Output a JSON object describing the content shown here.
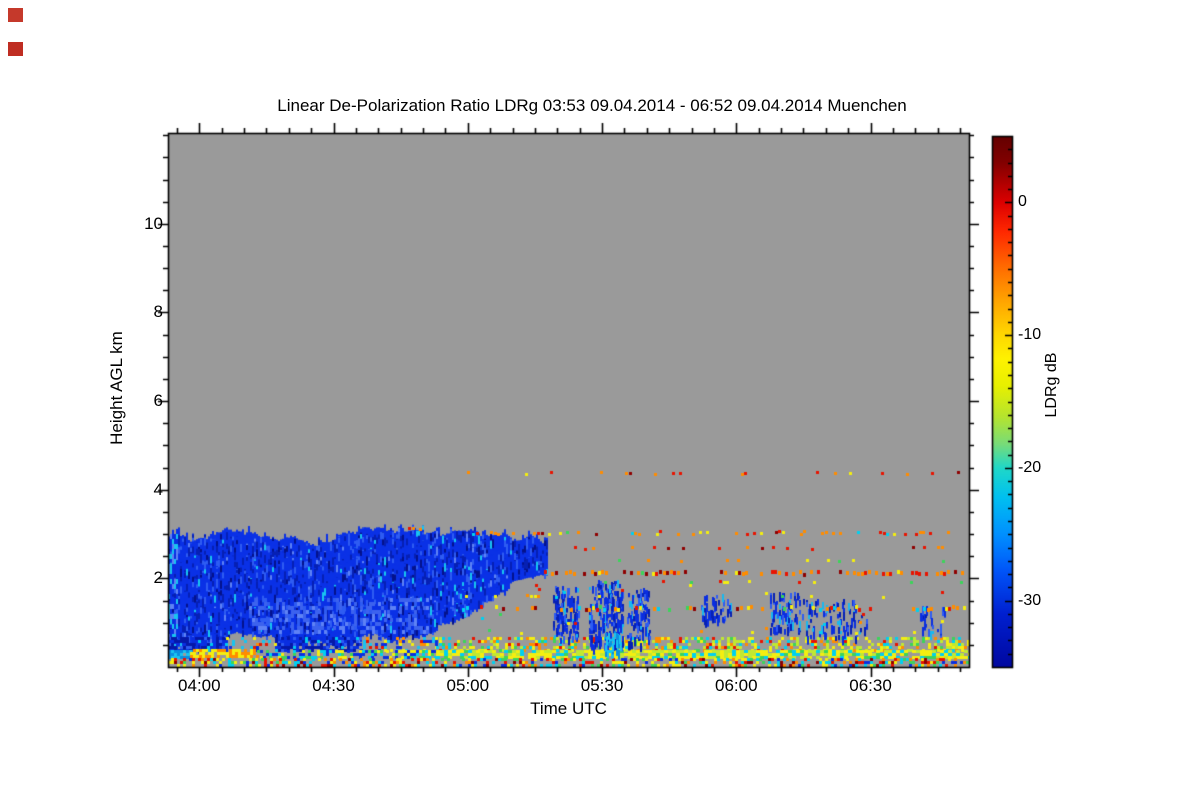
{
  "title": "Linear De-Polarization Ratio LDRg   03:53 09.04.2014 - 06:52 09.04.2014 Muenchen",
  "corner_markers": [
    {
      "color": "#c5392b"
    },
    {
      "color": "#bf2d22"
    }
  ],
  "axes": {
    "x": {
      "label": "Time UTC",
      "start_label": "03:53",
      "end_label": "06:52",
      "total_minutes": 179,
      "minor_step_min": 5,
      "ticks": [
        {
          "label": "04:00",
          "min": 7
        },
        {
          "label": "04:30",
          "min": 37
        },
        {
          "label": "05:00",
          "min": 67
        },
        {
          "label": "05:30",
          "min": 97
        },
        {
          "label": "06:00",
          "min": 127
        },
        {
          "label": "06:30",
          "min": 157
        }
      ]
    },
    "y": {
      "label": "Height AGL km",
      "min_km": 0,
      "max_km": 12.05,
      "minor_step_km": 0.5,
      "ticks": [
        {
          "label": "2",
          "km": 2
        },
        {
          "label": "4",
          "km": 4
        },
        {
          "label": "6",
          "km": 6
        },
        {
          "label": "8",
          "km": 8
        },
        {
          "label": "10",
          "km": 10
        }
      ]
    }
  },
  "colorbar": {
    "label": "LDRg dB",
    "max": 5,
    "min": -35,
    "minor_step": 1,
    "ticks": [
      {
        "label": "0",
        "value": 0
      },
      {
        "label": "-10",
        "value": -10
      },
      {
        "label": "-20",
        "value": -20
      },
      {
        "label": "-30",
        "value": -30
      }
    ],
    "gradient": [
      [
        0.0,
        "#640000"
      ],
      [
        0.05,
        "#820000"
      ],
      [
        0.125,
        "#dc0000"
      ],
      [
        0.18,
        "#ff2800"
      ],
      [
        0.25,
        "#ff6e00"
      ],
      [
        0.31,
        "#ffa400"
      ],
      [
        0.375,
        "#ffd800"
      ],
      [
        0.42,
        "#fef200"
      ],
      [
        0.47,
        "#e8f000"
      ],
      [
        0.53,
        "#b4e430"
      ],
      [
        0.58,
        "#78dc78"
      ],
      [
        0.625,
        "#20d8c8"
      ],
      [
        0.68,
        "#00c0f0"
      ],
      [
        0.75,
        "#0090ff"
      ],
      [
        0.82,
        "#0054f8"
      ],
      [
        0.9,
        "#0020d0"
      ],
      [
        1.0,
        "#0008a0"
      ]
    ]
  },
  "chart_data": {
    "type": "heatmap",
    "title": "Linear De-Polarization Ratio LDRg   03:53 09.04.2014 - 06:52 09.04.2014 Muenchen",
    "xlabel": "Time UTC",
    "ylabel": "Height AGL km",
    "x_range_minutes": [
      0,
      179
    ],
    "y_range_km": [
      0,
      12.05
    ],
    "value_range_db": [
      -35,
      5
    ],
    "background": "#9a9a9a",
    "seed": 20140409,
    "palettes": {
      "cloud": [
        [
          "#0a31e6",
          0.5
        ],
        [
          "#0620b4",
          0.2
        ],
        [
          "#04128c",
          0.08
        ],
        [
          "#2e5cf2",
          0.15
        ],
        [
          "#18c4f0",
          0.04
        ],
        [
          "#5e82f5",
          0.03
        ]
      ],
      "blues": [
        [
          "#0a2ee0",
          0.45
        ],
        [
          "#0620b4",
          0.25
        ],
        [
          "#2e5cf2",
          0.2
        ],
        [
          "#18b8f0",
          0.1
        ]
      ],
      "cyanBlue": [
        [
          "#18c4f0",
          0.55
        ],
        [
          "#0a8ee0",
          0.45
        ]
      ],
      "paleBlues": [
        [
          "#3c62ee",
          0.5
        ],
        [
          "#5e82f5",
          0.3
        ],
        [
          "#2e5cf2",
          0.2
        ]
      ],
      "edgeMix": [
        [
          "#18c4f0",
          0.4
        ],
        [
          "#5e82f5",
          0.3
        ],
        [
          "#0a2ee0",
          0.3
        ]
      ],
      "bluesB": [
        [
          "#0518a8",
          0.4
        ],
        [
          "#0a2ee0",
          0.35
        ],
        [
          "#00c8f0",
          0.1
        ],
        [
          "#2e5cf2",
          0.15
        ]
      ],
      "mixLeft": [
        [
          "#0a2ee0",
          0.3
        ],
        [
          "#18c4f0",
          0.2
        ],
        [
          "#f4ee10",
          0.2
        ],
        [
          "#ff8c00",
          0.15
        ],
        [
          "#e81400",
          0.15
        ]
      ],
      "warmMix": [
        [
          "#f4ee10",
          0.3
        ],
        [
          "#c0e832",
          0.25
        ],
        [
          "#ff8c00",
          0.15
        ],
        [
          "#00d0f0",
          0.12
        ],
        [
          "#3cd45a",
          0.1
        ],
        [
          "#e81400",
          0.08
        ]
      ],
      "brightLine": [
        [
          "#f4ee10",
          0.45
        ],
        [
          "#c0e832",
          0.3
        ],
        [
          "#00d0f0",
          0.15
        ],
        [
          "#3cd45a",
          0.1
        ]
      ],
      "mixB": [
        [
          "#0a2ee0",
          0.3
        ],
        [
          "#00d0f0",
          0.25
        ],
        [
          "#f4ee10",
          0.25
        ],
        [
          "#3cd45a",
          0.2
        ]
      ],
      "groundMix": [
        [
          "#f4ee10",
          0.2
        ],
        [
          "#00d0f0",
          0.18
        ],
        [
          "#e81400",
          0.14
        ],
        [
          "#ff8c00",
          0.14
        ],
        [
          "#3cd45a",
          0.12
        ],
        [
          "#0a2ee0",
          0.12
        ],
        [
          "#8f0000",
          0.1
        ]
      ],
      "warmDots": [
        [
          "#ff8c00",
          0.4
        ],
        [
          "#e81400",
          0.25
        ],
        [
          "#f4ee10",
          0.25
        ],
        [
          "#8f0000",
          0.1
        ]
      ],
      "redDots": [
        [
          "#e81400",
          0.55
        ],
        [
          "#ff8c00",
          0.3
        ],
        [
          "#8f0000",
          0.15
        ]
      ],
      "rowMain": [
        [
          "#ff8c00",
          0.35
        ],
        [
          "#e81400",
          0.3
        ],
        [
          "#f4ee10",
          0.15
        ],
        [
          "#8f0000",
          0.12
        ],
        [
          "#3cd45a",
          0.04
        ],
        [
          "#00d0f0",
          0.04
        ]
      ],
      "rowHot": [
        [
          "#ff8c00",
          0.35
        ],
        [
          "#e81400",
          0.25
        ],
        [
          "#8f0000",
          0.25
        ],
        [
          "#f4ee10",
          0.1
        ],
        [
          "#3cd45a",
          0.05
        ]
      ],
      "rowMulti": [
        [
          "#ff8c00",
          0.3
        ],
        [
          "#f4ee10",
          0.25
        ],
        [
          "#e81400",
          0.15
        ],
        [
          "#00d0f0",
          0.12
        ],
        [
          "#3cd45a",
          0.08
        ],
        [
          "#8f0000",
          0.1
        ]
      ],
      "mixDots": [
        [
          "#f4ee10",
          0.3
        ],
        [
          "#e81400",
          0.25
        ],
        [
          "#3cd45a",
          0.2
        ],
        [
          "#00d0f0",
          0.15
        ],
        [
          "#ff8c00",
          0.1
        ]
      ],
      "yg": [
        [
          "#f4ee10",
          0.5
        ],
        [
          "#3cd45a",
          0.3
        ],
        [
          "#ff8c00",
          0.2
        ]
      ],
      "yo": [
        [
          "#f4ee10",
          0.6
        ],
        [
          "#ff8c00",
          0.4
        ]
      ]
    },
    "cloud": {
      "base_color": "#0a31e6",
      "palette": "cloud",
      "segments": [
        {
          "m0": 0,
          "m1": 13,
          "top": 2.95,
          "b0": 0.45,
          "b1": 0.5
        },
        {
          "m0": 13,
          "m1": 24,
          "top": 2.9,
          "b0": 0.8,
          "b1": 0.8
        },
        {
          "m0": 24,
          "m1": 43,
          "top": 2.92,
          "b0": 0.55,
          "b1": 0.6
        },
        {
          "m0": 43,
          "m1": 60,
          "top": 2.95,
          "b0": 0.72,
          "b1": 0.75
        },
        {
          "m0": 60,
          "m1": 76,
          "top": 2.88,
          "b0": 0.9,
          "b1": 1.6
        },
        {
          "m0": 76,
          "m1": 84.5,
          "top": 2.8,
          "b0": 1.75,
          "b1": 1.95
        }
      ]
    },
    "rows": [
      {
        "km": 4.37,
        "m0": 62,
        "m1": 178,
        "d": 0.13,
        "pal": "warmDots",
        "w": 3,
        "h": 3,
        "j": 1
      },
      {
        "km": 3.12,
        "m0": 48,
        "m1": 60,
        "d": 0.22,
        "pal": "redDots",
        "w": 3,
        "h": 3,
        "j": 1
      },
      {
        "km": 3.02,
        "m0": 68,
        "m1": 178,
        "d": 0.38,
        "pal": "rowMain",
        "w": 3,
        "h": 3,
        "j": 1.5
      },
      {
        "km": 2.68,
        "m0": 85,
        "m1": 178,
        "d": 0.15,
        "pal": "redDots",
        "w": 3,
        "h": 3,
        "j": 1
      },
      {
        "km": 2.4,
        "m0": 95,
        "m1": 175,
        "d": 0.08,
        "pal": "yg",
        "w": 3,
        "h": 3,
        "j": 1
      },
      {
        "km": 2.12,
        "m0": 84,
        "m1": 178,
        "d": 0.5,
        "pal": "rowHot",
        "w": 3,
        "h": 4,
        "j": 1.5
      },
      {
        "km": 1.92,
        "m0": 95,
        "m1": 178,
        "d": 0.09,
        "pal": "mixDots",
        "w": 3,
        "h": 3,
        "j": 1
      },
      {
        "km": 1.58,
        "m0": 64,
        "m1": 84,
        "d": 0.3,
        "pal": "yo",
        "w": 3,
        "h": 3,
        "j": 1
      },
      {
        "km": 1.58,
        "m0": 84,
        "m1": 178,
        "d": 0.05,
        "pal": "mixDots",
        "w": 3,
        "h": 3,
        "j": 1
      },
      {
        "km": 1.32,
        "m0": 65,
        "m1": 178,
        "d": 0.45,
        "pal": "rowMulti",
        "w": 3,
        "h": 4,
        "j": 1.5
      },
      {
        "km": 1.0,
        "m0": 61,
        "m1": 178,
        "d": 0.1,
        "pal": "mixDots",
        "w": 3,
        "h": 3,
        "j": 11
      },
      {
        "km": 1.7,
        "m0": 61,
        "m1": 178,
        "d": 0.05,
        "pal": "mixDots",
        "w": 3,
        "h": 3,
        "j": 8
      }
    ],
    "patches": [
      {
        "m0": 86,
        "m1": 92,
        "k0": 0.5,
        "k1": 1.85,
        "d": 0.5,
        "pal": "blues"
      },
      {
        "m0": 94,
        "m1": 102,
        "k0": 0.35,
        "k1": 2.0,
        "d": 0.55,
        "pal": "blues"
      },
      {
        "m0": 102.5,
        "m1": 108,
        "k0": 0.4,
        "k1": 1.78,
        "d": 0.45,
        "pal": "blues"
      },
      {
        "m0": 119,
        "m1": 126,
        "k0": 0.9,
        "k1": 1.67,
        "d": 0.3,
        "pal": "blues"
      },
      {
        "m0": 134.5,
        "m1": 141.5,
        "k0": 0.7,
        "k1": 1.7,
        "d": 0.42,
        "pal": "blues"
      },
      {
        "m0": 141.5,
        "m1": 156.5,
        "k0": 0.55,
        "k1": 1.55,
        "d": 0.2,
        "pal": "blues"
      },
      {
        "m0": 168,
        "m1": 174,
        "k0": 0.6,
        "k1": 1.4,
        "d": 0.18,
        "pal": "blues"
      },
      {
        "m0": 97.5,
        "m1": 101.5,
        "k0": 0.2,
        "k1": 0.85,
        "d": 0.5,
        "pal": "cyanBlue"
      }
    ],
    "bands": [
      {
        "m0": 18,
        "m1": 58,
        "k0": 0.8,
        "k1": 1.55,
        "d": 0.4,
        "pal": "paleBlues",
        "w": 3,
        "h": 4
      },
      {
        "m0": 0,
        "m1": 1.8,
        "k0": 0.2,
        "k1": 3.0,
        "d": 0.6,
        "pal": "edgeMix",
        "w": 2,
        "h": 5
      },
      {
        "m0": 0,
        "m1": 13,
        "k0": 0.38,
        "k1": 0.68,
        "d": 0.8,
        "pal": "bluesB",
        "w": 3,
        "h": 3
      },
      {
        "m0": 13,
        "m1": 24,
        "k0": 0.38,
        "k1": 0.68,
        "d": 0.3,
        "pal": "mixLeft",
        "w": 3,
        "h": 3
      },
      {
        "m0": 24,
        "m1": 43,
        "k0": 0.38,
        "k1": 0.68,
        "d": 0.75,
        "pal": "bluesB",
        "w": 3,
        "h": 3
      },
      {
        "m0": 43,
        "m1": 60,
        "k0": 0.38,
        "k1": 0.68,
        "d": 0.35,
        "pal": "mixLeft",
        "w": 3,
        "h": 3
      },
      {
        "m0": 60,
        "m1": 179,
        "k0": 0.38,
        "k1": 0.68,
        "d": 0.5,
        "pal": "warmMix",
        "w": 3,
        "h": 3
      },
      {
        "m0": 0,
        "m1": 6,
        "k0": 0.2,
        "k1": 0.38,
        "d": 0.92,
        "pal": "cyanBlue",
        "w": 3,
        "h": 3
      },
      {
        "m0": 5,
        "m1": 20,
        "k0": 0.22,
        "k1": 0.4,
        "d": 0.8,
        "pal": "yo",
        "w": 3,
        "h": 3
      },
      {
        "m0": 20,
        "m1": 60,
        "k0": 0.2,
        "k1": 0.38,
        "d": 0.6,
        "pal": "mixB",
        "w": 3,
        "h": 3
      },
      {
        "m0": 60,
        "m1": 179,
        "k0": 0.2,
        "k1": 0.38,
        "d": 0.88,
        "pal": "brightLine",
        "w": 4,
        "h": 3
      },
      {
        "m0": 0,
        "m1": 179,
        "k0": 0.02,
        "k1": 0.2,
        "d": 0.5,
        "pal": "groundMix",
        "w": 3,
        "h": 3
      }
    ]
  }
}
